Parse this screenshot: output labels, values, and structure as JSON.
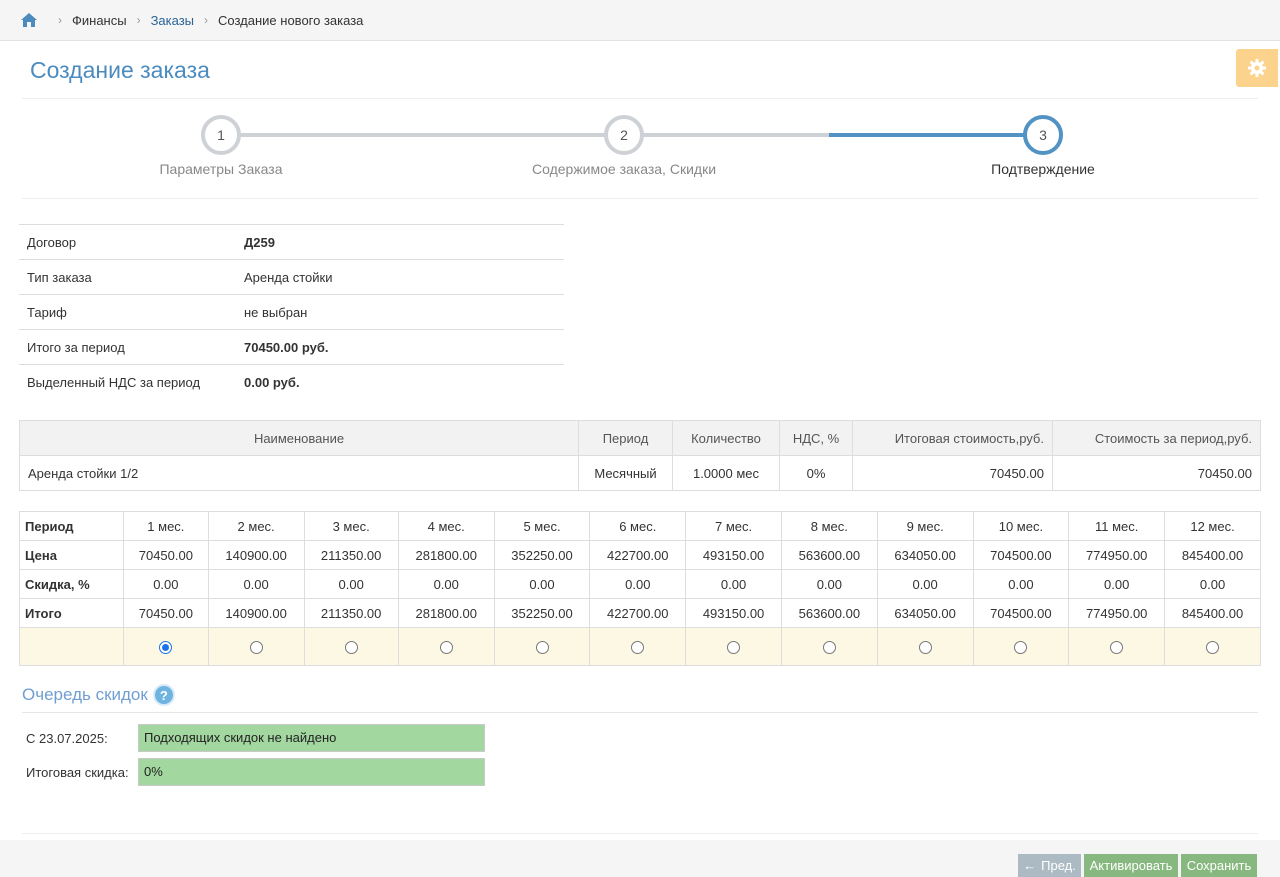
{
  "breadcrumb": {
    "home_icon": "home-icon",
    "items": [
      "Финансы",
      "Заказы",
      "Создание нового заказа"
    ]
  },
  "page": {
    "title": "Создание заказа",
    "settings_icon": "gear-icon"
  },
  "wizard": {
    "steps": [
      {
        "num": "1",
        "label": "Параметры Заказа"
      },
      {
        "num": "2",
        "label": "Содержимое заказа, Скидки"
      },
      {
        "num": "3",
        "label": "Подтверждение"
      }
    ],
    "current_step": 3,
    "colors": {
      "done_line": "#ced1d6",
      "active": "#5293c4"
    }
  },
  "info": [
    {
      "label": "Договор",
      "value": "Д259",
      "bold": true
    },
    {
      "label": "Тип заказа",
      "value": "Аренда стойки",
      "bold": false
    },
    {
      "label": "Тариф",
      "value": "не выбран",
      "bold": false
    },
    {
      "label": "Итого за период",
      "value": "70450.00 руб.",
      "bold": true
    },
    {
      "label": "Выделенный НДС за период",
      "value": "0.00 руб.",
      "bold": true
    }
  ],
  "items_table": {
    "headers": [
      "Наименование",
      "Период",
      "Количество",
      "НДС, %",
      "Итоговая стоимость,руб.",
      "Стоимость за период,руб."
    ],
    "rows": [
      [
        "Аренда стойки 1/2",
        "Месячный",
        "1.0000 мес",
        "0%",
        "70450.00",
        "70450.00"
      ]
    ]
  },
  "period_table": {
    "row_labels": [
      "Период",
      "Цена",
      "Скидка, %",
      "Итого"
    ],
    "periods": [
      "1 мес.",
      "2 мес.",
      "3 мес.",
      "4 мес.",
      "5 мес.",
      "6 мес.",
      "7 мес.",
      "8 мес.",
      "9 мес.",
      "10 мес.",
      "11 мес.",
      "12 мес."
    ],
    "prices": [
      "70450.00",
      "140900.00",
      "211350.00",
      "281800.00",
      "352250.00",
      "422700.00",
      "493150.00",
      "563600.00",
      "634050.00",
      "704500.00",
      "774950.00",
      "845400.00"
    ],
    "discounts": [
      "0.00",
      "0.00",
      "0.00",
      "0.00",
      "0.00",
      "0.00",
      "0.00",
      "0.00",
      "0.00",
      "0.00",
      "0.00",
      "0.00"
    ],
    "totals": [
      "70450.00",
      "140900.00",
      "211350.00",
      "281800.00",
      "352250.00",
      "422700.00",
      "493150.00",
      "563600.00",
      "634050.00",
      "704500.00",
      "774950.00",
      "845400.00"
    ],
    "selected_index": 0
  },
  "discount_queue": {
    "title": "Очередь скидок",
    "help_icon": "question-icon",
    "rows": [
      {
        "label": "С 23.07.2025:",
        "value": "Подходящих скидок не найдено"
      },
      {
        "label": "Итоговая скидка:",
        "value": "0%"
      }
    ],
    "field_color": "#a3d7a0"
  },
  "footer": {
    "prev_label": "Пред.",
    "activate_label": "Активировать",
    "save_label": "Сохранить"
  }
}
